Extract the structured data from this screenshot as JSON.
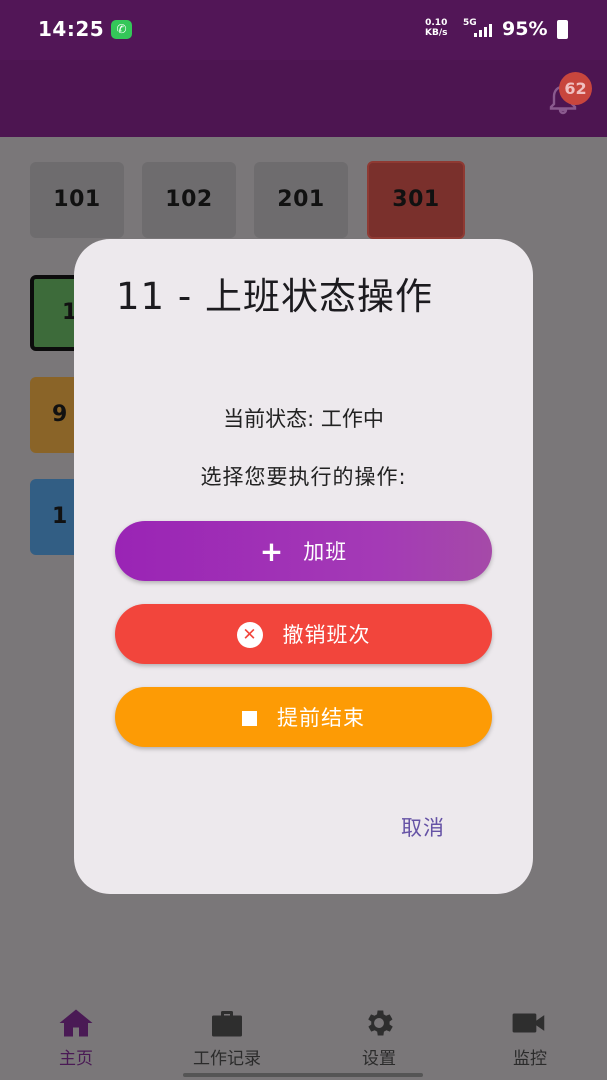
{
  "status_bar": {
    "time": "14:25",
    "net_speed_value": "0.10",
    "net_speed_unit": "KB/s",
    "signal_type": "5G",
    "battery": "95%"
  },
  "app_bar": {
    "notification_count": "62"
  },
  "rooms": [
    "101",
    "102",
    "201",
    "301"
  ],
  "side_cards": [
    "1",
    "9",
    "1"
  ],
  "colors": {
    "header": "#521657",
    "overtime": "#9a24b5",
    "cancel_shift": "#f2453c",
    "end_early": "#fd9b05",
    "text_button": "#6552a5"
  },
  "dialog": {
    "title": "11 - 上班状态操作",
    "status_line": "当前状态: 工作中",
    "prompt": "选择您要执行的操作:",
    "buttons": {
      "overtime": {
        "label": "加班",
        "icon": "plus-icon"
      },
      "cancel_shift": {
        "label": "撤销班次",
        "icon": "cancel-circle-icon"
      },
      "end_early": {
        "label": "提前结束",
        "icon": "stop-icon"
      }
    },
    "cancel_label": "取消"
  },
  "bottom_nav": [
    {
      "label": "主页",
      "icon": "home-icon"
    },
    {
      "label": "工作记录",
      "icon": "briefcase-icon"
    },
    {
      "label": "设置",
      "icon": "gear-icon"
    },
    {
      "label": "监控",
      "icon": "videocam-icon"
    }
  ]
}
